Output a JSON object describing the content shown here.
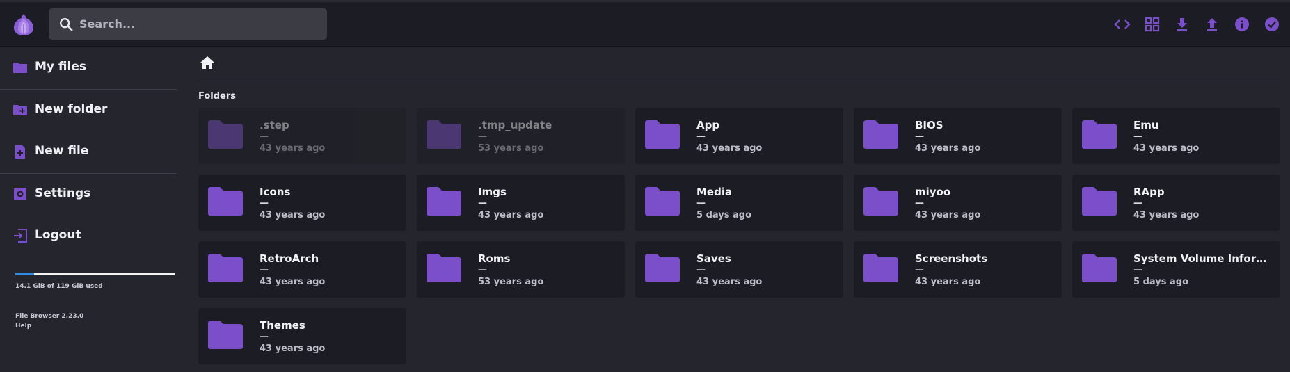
{
  "header": {
    "search_placeholder": "Search...",
    "accent_color": "#7b4fc9",
    "actions": [
      {
        "name": "toggle-code-view",
        "icon": "code-icon"
      },
      {
        "name": "switch-view",
        "icon": "grid-view-icon"
      },
      {
        "name": "download",
        "icon": "download-icon"
      },
      {
        "name": "upload",
        "icon": "upload-icon"
      },
      {
        "name": "info",
        "icon": "info-icon"
      },
      {
        "name": "select-multiple",
        "icon": "check-circle-icon"
      }
    ]
  },
  "sidebar": {
    "items": [
      {
        "label": "My files",
        "icon": "folder-icon"
      },
      {
        "label": "New folder",
        "icon": "create-folder-icon"
      },
      {
        "label": "New file",
        "icon": "note-add-icon"
      },
      {
        "label": "Settings",
        "icon": "settings-icon"
      },
      {
        "label": "Logout",
        "icon": "exit-icon"
      }
    ],
    "usage": {
      "text": "14.1 GiB of 119 GiB used",
      "used_fraction": 0.118
    },
    "version": "File Browser 2.23.0",
    "help": "Help"
  },
  "main": {
    "breadcrumb_icon": "home-icon",
    "section_title": "Folders",
    "folders": [
      {
        "name": ".step",
        "size": "—",
        "modified": "43 years ago",
        "hidden": true
      },
      {
        "name": ".tmp_update",
        "size": "—",
        "modified": "53 years ago",
        "hidden": true
      },
      {
        "name": "App",
        "size": "—",
        "modified": "43 years ago",
        "hidden": false
      },
      {
        "name": "BIOS",
        "size": "—",
        "modified": "43 years ago",
        "hidden": false
      },
      {
        "name": "Emu",
        "size": "—",
        "modified": "43 years ago",
        "hidden": false
      },
      {
        "name": "Icons",
        "size": "—",
        "modified": "43 years ago",
        "hidden": false
      },
      {
        "name": "Imgs",
        "size": "—",
        "modified": "43 years ago",
        "hidden": false
      },
      {
        "name": "Media",
        "size": "—",
        "modified": "5 days ago",
        "hidden": false
      },
      {
        "name": "miyoo",
        "size": "—",
        "modified": "43 years ago",
        "hidden": false
      },
      {
        "name": "RApp",
        "size": "—",
        "modified": "43 years ago",
        "hidden": false
      },
      {
        "name": "RetroArch",
        "size": "—",
        "modified": "43 years ago",
        "hidden": false
      },
      {
        "name": "Roms",
        "size": "—",
        "modified": "53 years ago",
        "hidden": false
      },
      {
        "name": "Saves",
        "size": "—",
        "modified": "43 years ago",
        "hidden": false
      },
      {
        "name": "Screenshots",
        "size": "—",
        "modified": "43 years ago",
        "hidden": false
      },
      {
        "name": "System Volume Inform...",
        "size": "—",
        "modified": "5 days ago",
        "hidden": false
      },
      {
        "name": "Themes",
        "size": "—",
        "modified": "43 years ago",
        "hidden": false
      }
    ]
  }
}
